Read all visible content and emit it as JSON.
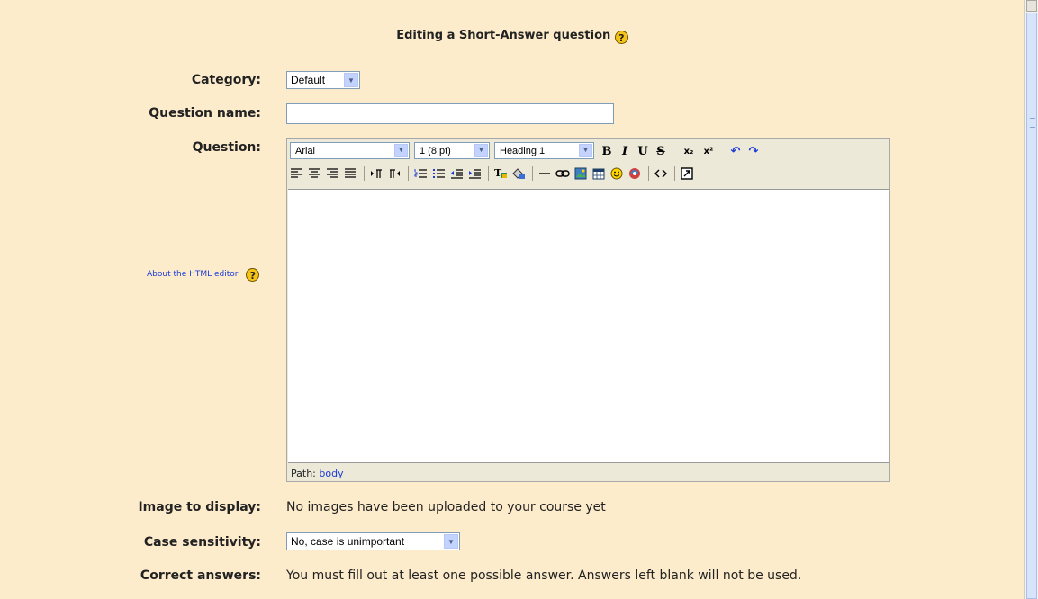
{
  "form": {
    "title": "Editing a Short-Answer question",
    "help_glyph": "?",
    "category": {
      "label": "Category:",
      "value": "Default"
    },
    "question_name": {
      "label": "Question name:",
      "value": ""
    },
    "question": {
      "label": "Question:"
    },
    "about_editor": "About the HTML editor",
    "image": {
      "label": "Image to display:",
      "value": "No images have been uploaded to your course yet"
    },
    "case_sensitivity": {
      "label": "Case sensitivity:",
      "value": "No, case is unimportant"
    },
    "correct_answers": {
      "label": "Correct answers:",
      "value": "You must fill out at least one possible answer. Answers left blank will not be used."
    }
  },
  "editor": {
    "font": "Arial",
    "size": "1 (8 pt)",
    "heading": "Heading 1",
    "bold": "B",
    "italic": "I",
    "underline": "U",
    "strike": "S",
    "subscript": "x₂",
    "superscript": "x²",
    "undo": "↶",
    "redo": "↷",
    "path_label": "Path:",
    "path_value": "body"
  },
  "toolbar_icons": [
    "align-left-icon",
    "align-center-icon",
    "align-right-icon",
    "justify-icon",
    "ltr-icon",
    "rtl-icon",
    "ordered-list-icon",
    "unordered-list-icon",
    "outdent-icon",
    "indent-icon",
    "text-color-icon",
    "bg-color-icon",
    "horizontal-rule-icon",
    "link-icon",
    "image-icon",
    "table-icon",
    "smiley-icon",
    "special-char-icon",
    "html-source-icon",
    "fullscreen-icon"
  ]
}
